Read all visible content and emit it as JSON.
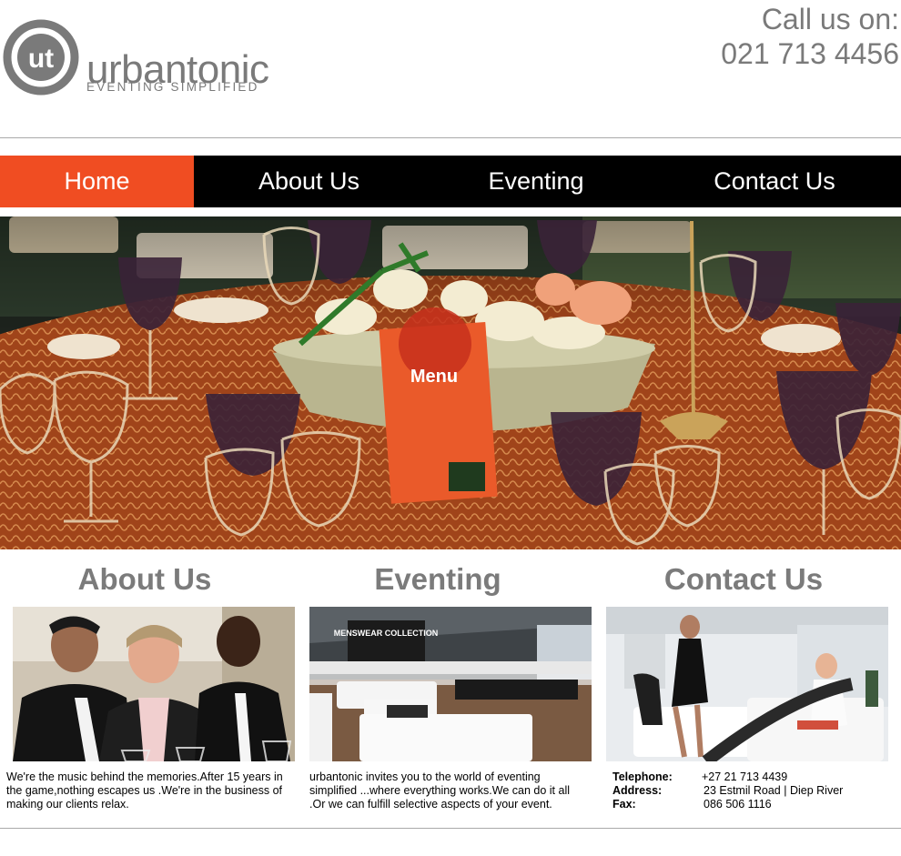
{
  "brand": {
    "logo_monogram": "ut",
    "name": "urbantonic",
    "tagline": "EVENTING SIMPLIFIED"
  },
  "header": {
    "call_label": "Call us on:",
    "phone": "021 713 4456"
  },
  "nav": {
    "items": [
      {
        "label": "Home",
        "active": true
      },
      {
        "label": "About Us",
        "active": false
      },
      {
        "label": "Eventing",
        "active": false
      },
      {
        "label": "Contact Us",
        "active": false
      }
    ]
  },
  "hero": {
    "menu_card_text": "Menu"
  },
  "sections": {
    "about": {
      "title": "About Us",
      "text": "We're the music behind the memories.After 15 years in the game,nothing escapes us .We're in the business of making our clients relax."
    },
    "eventing": {
      "title": "Eventing",
      "banner_text": "MENSWEAR COLLECTION",
      "text": "urbantonic invites you to the world of eventing simplified ...where everything works.We can do it all .Or we can fulfill selective aspects of your event."
    },
    "contact": {
      "title": "Contact Us",
      "telephone_label": "Telephone:",
      "telephone": "+27 21 713 4439",
      "address_label": "Address:",
      "address": "23 Estmil Road | Diep River",
      "fax_label": "Fax:",
      "fax": "086 506 1116"
    }
  },
  "colors": {
    "accent": "#f04d22",
    "nav_bg": "#000000",
    "text_gray": "#7a7a7a"
  }
}
